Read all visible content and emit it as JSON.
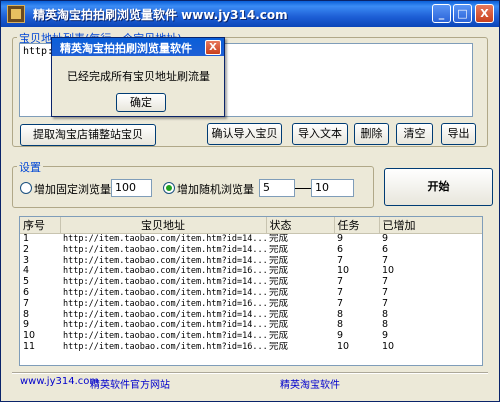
{
  "window": {
    "title": "精英淘宝拍拍刷浏览量软件 www.jy314.com",
    "min_label": "_",
    "max_label": "□",
    "close_label": "X"
  },
  "url_group": {
    "label": "宝贝地址列表(每行一个宝贝地址)",
    "textarea_value": "http://"
  },
  "buttons": {
    "extract": "提取淘宝店铺整站宝贝",
    "confirm_import": "确认导入宝贝",
    "import_text": "导入文本",
    "delete": "删除",
    "clear": "清空",
    "export": "导出",
    "start": "开始"
  },
  "settings": {
    "label": "设置",
    "fixed_label": "增加固定浏览量",
    "fixed_value": "100",
    "random_label": "增加随机浏览量",
    "random_min": "5",
    "random_max": "10"
  },
  "table": {
    "headers": [
      "序号",
      "宝贝地址",
      "状态",
      "任务",
      "已增加"
    ],
    "rows": [
      [
        "1",
        "http://item.taobao.com/item.htm?id=14...",
        "完成",
        "9",
        "9"
      ],
      [
        "2",
        "http://item.taobao.com/item.htm?id=14...",
        "完成",
        "6",
        "6"
      ],
      [
        "3",
        "http://item.taobao.com/item.htm?id=14...",
        "完成",
        "7",
        "7"
      ],
      [
        "4",
        "http://item.taobao.com/item.htm?id=16...",
        "完成",
        "10",
        "10"
      ],
      [
        "5",
        "http://item.taobao.com/item.htm?id=14...",
        "完成",
        "7",
        "7"
      ],
      [
        "6",
        "http://item.taobao.com/item.htm?id=14...",
        "完成",
        "7",
        "7"
      ],
      [
        "7",
        "http://item.taobao.com/item.htm?id=16...",
        "完成",
        "7",
        "7"
      ],
      [
        "8",
        "http://item.taobao.com/item.htm?id=14...",
        "完成",
        "8",
        "8"
      ],
      [
        "9",
        "http://item.taobao.com/item.htm?id=14...",
        "完成",
        "8",
        "8"
      ],
      [
        "10",
        "http://item.taobao.com/item.htm?id=14...",
        "完成",
        "9",
        "9"
      ],
      [
        "11",
        "http://item.taobao.com/item.htm?id=16...",
        "完成",
        "10",
        "10"
      ]
    ]
  },
  "footer": {
    "site": "www.jy314.com",
    "site_label": "精英软件官方网站",
    "product": "精英淘宝软件"
  },
  "dialog": {
    "title": "精英淘宝拍拍刷浏览量软件",
    "close_label": "X",
    "message": "已经完成所有宝贝地址刷流量",
    "ok_label": "确定"
  },
  "colors": {
    "titlebar": "#1e5fd6",
    "window_bg": "#ece9d8",
    "group_label": "#0046d5",
    "link": "#0000cc"
  }
}
